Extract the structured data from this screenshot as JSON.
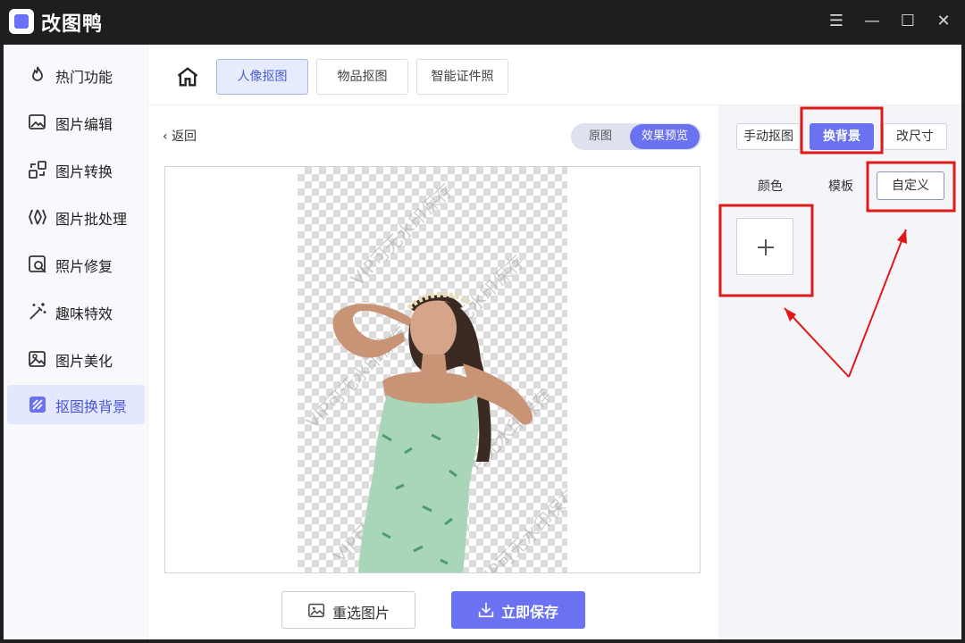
{
  "app": {
    "title": "改图鸭",
    "window_controls": [
      "menu-icon",
      "minimize-icon",
      "maximize-icon",
      "close-icon"
    ]
  },
  "sidebar": {
    "items": [
      {
        "label": "热门功能",
        "icon": "flame-icon"
      },
      {
        "label": "图片编辑",
        "icon": "image-edit-icon"
      },
      {
        "label": "图片转换",
        "icon": "convert-icon"
      },
      {
        "label": "图片批处理",
        "icon": "batch-icon"
      },
      {
        "label": "照片修复",
        "icon": "photo-repair-icon"
      },
      {
        "label": "趣味特效",
        "icon": "magic-wand-icon"
      },
      {
        "label": "图片美化",
        "icon": "beautify-icon"
      },
      {
        "label": "抠图换背景",
        "icon": "cutout-icon",
        "active": true
      }
    ]
  },
  "top_tabs": [
    {
      "label": "人像抠图",
      "active": true
    },
    {
      "label": "物品抠图",
      "active": false
    },
    {
      "label": "智能证件照",
      "active": false
    }
  ],
  "preview": {
    "back_label": "返回",
    "toggle": {
      "original": "原图",
      "effect": "效果预览",
      "selected": "效果预览"
    },
    "watermark": "VIP可无水印保存",
    "reselect_label": "重选图片",
    "save_label": "立即保存"
  },
  "right_panel": {
    "tabs": [
      {
        "label": "手动抠图",
        "active": false
      },
      {
        "label": "换背景",
        "active": true
      },
      {
        "label": "改尺寸",
        "active": false
      }
    ],
    "options": [
      "颜色",
      "模板",
      "自定义"
    ],
    "selected_option": "自定义"
  },
  "colors": {
    "accent": "#6b72f2",
    "annotation_red": "#e01818",
    "titlebar": "#1e1e1e",
    "sidebar_active_bg": "#e3e8ff"
  }
}
